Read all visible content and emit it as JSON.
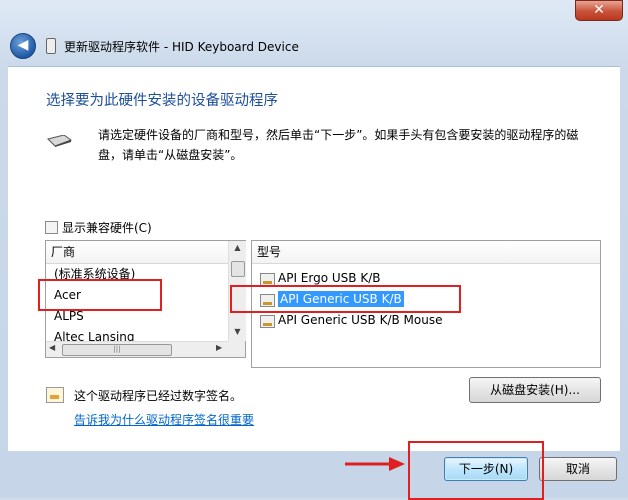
{
  "window": {
    "blurred_title": "",
    "close_symbol": "✕"
  },
  "nav": {
    "back_symbol": "◀",
    "title": "更新驱动程序软件 - HID Keyboard Device"
  },
  "content": {
    "heading": "选择要为此硬件安装的设备驱动程序",
    "description": "请选定硬件设备的厂商和型号，然后单击“下一步”。如果手头有包含要安装的驱动程序的磁盘，请单击“从磁盘安装”。",
    "show_compatible_label": "显示兼容硬件(C)",
    "show_compatible_checked": false
  },
  "manufacturer_list": {
    "header": "厂商",
    "items": [
      "(标准系统设备)",
      "Acer",
      "ALPS",
      "Altec Lansing"
    ],
    "highlighted": "Acer"
  },
  "model_list": {
    "header": "型号",
    "items": [
      {
        "label": "API Ergo USB K/B",
        "selected": false
      },
      {
        "label": "API Generic USB K/B",
        "selected": true
      },
      {
        "label": "API Generic USB K/B Mouse",
        "selected": false
      }
    ]
  },
  "signature": {
    "status_text": "这个驱动程序已经过数字签名。",
    "link_text": "告诉我为什么驱动程序签名很重要"
  },
  "buttons": {
    "have_disk": "从磁盘安装(H)...",
    "next": "下一步(N)",
    "cancel": "取消"
  },
  "colors": {
    "heading": "#1e4f99",
    "selection": "#3399ff",
    "link": "#0066cc",
    "annotation_red": "#e02020"
  }
}
